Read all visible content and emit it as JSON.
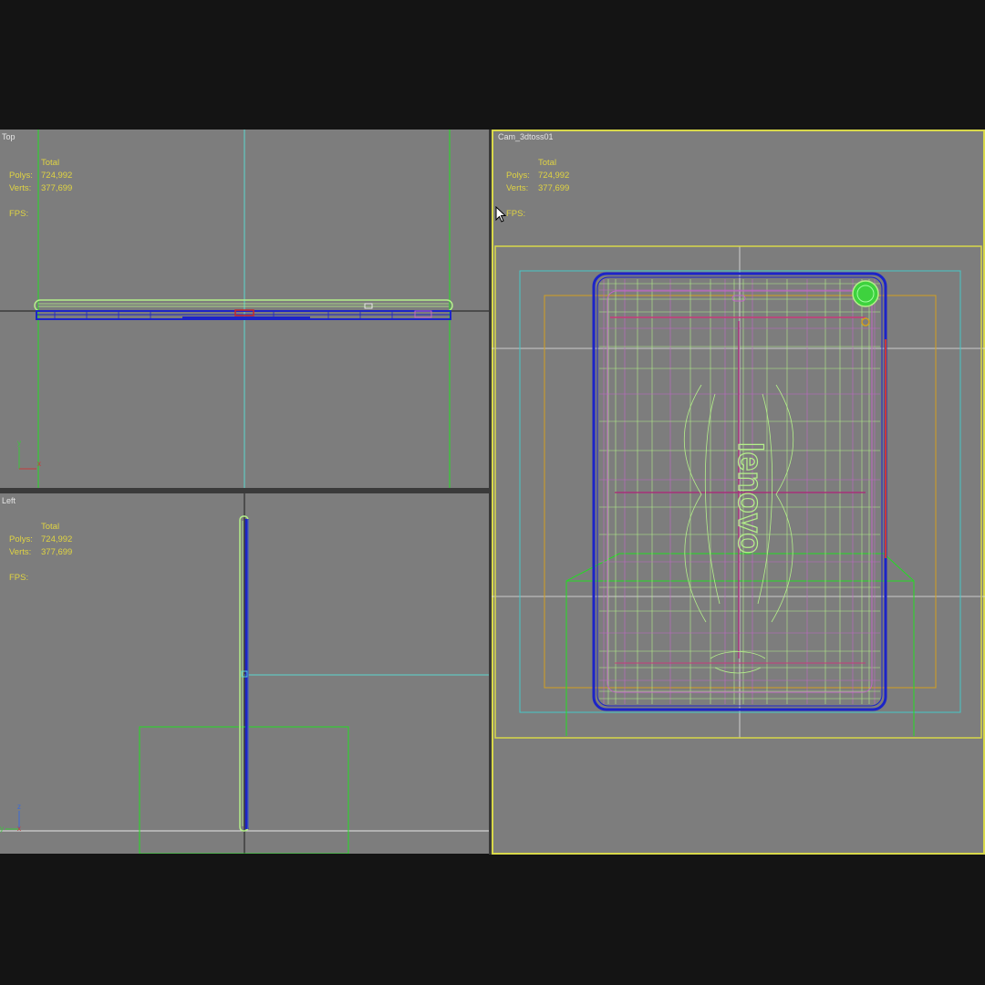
{
  "viewports": {
    "top": {
      "label": "Top"
    },
    "left": {
      "label": "Left"
    },
    "camera": {
      "label": "Cam_3dtoss01"
    }
  },
  "stats": {
    "header": "Total",
    "polys_label": "Polys:",
    "polys_value": "724,992",
    "verts_label": "Verts:",
    "verts_value": "377,699",
    "fps_label": "FPS:"
  },
  "model": {
    "brand_text": "lenovo"
  },
  "axis_tripod": {
    "top": [
      "y",
      "x"
    ],
    "left": [
      "z",
      "y",
      "x"
    ]
  },
  "colors": {
    "viewport_bg": "#7d7d7d",
    "active_border": "#d8d84a",
    "stats_text": "#e0d442",
    "wire_green": "#b4f08a",
    "wire_blue": "#1c24c8",
    "wire_magenta": "#c266c8",
    "grid_green": "#22dd22",
    "safe_frame_cyan": "#46c8c8",
    "safe_frame_orange": "#d2a020"
  },
  "icons": [
    "mouse-cursor-icon"
  ]
}
